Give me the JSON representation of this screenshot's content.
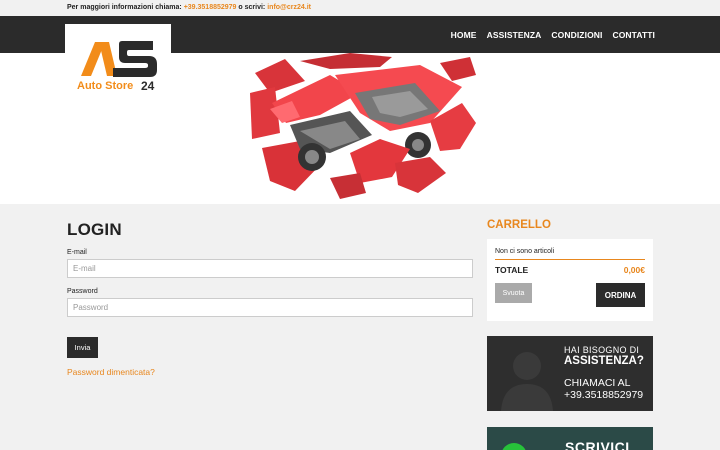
{
  "topbar": {
    "info_label": "Per maggiori informazioni chiama:",
    "phone": "+39.3518852979",
    "or_write": "o scrivi:",
    "email": "info@crz24.it"
  },
  "nav": {
    "items": [
      "HOME",
      "ASSISTENZA",
      "CONDIZIONI",
      "CONTATTI"
    ]
  },
  "logo": {
    "text": "Auto Store",
    "number": "24",
    "colors": {
      "orange": "#f28c1a",
      "dark": "#2b2b2b"
    }
  },
  "login": {
    "title": "LOGIN",
    "email_label": "E-mail",
    "email_placeholder": "E-mail",
    "password_label": "Password",
    "password_placeholder": "Password",
    "submit_label": "Invia",
    "forgot_label": "Password dimenticata?"
  },
  "cart": {
    "title": "CARRELLO",
    "empty_message": "Non ci sono articoli",
    "total_label": "TOTALE",
    "total_value": "0,00€",
    "clear_label": "Svuota",
    "order_label": "ORDINA"
  },
  "assist_banner": {
    "line1": "HAI BISOGNO DI",
    "line2": "ASSISTENZA?",
    "line3": "CHIAMACI AL",
    "line4": "+39.3518852979"
  },
  "whatsapp_banner": {
    "text": "SCRIVICI SU"
  },
  "colors": {
    "accent": "#e8871e",
    "dark": "#2b2b2b",
    "background": "#f1f1f1"
  }
}
